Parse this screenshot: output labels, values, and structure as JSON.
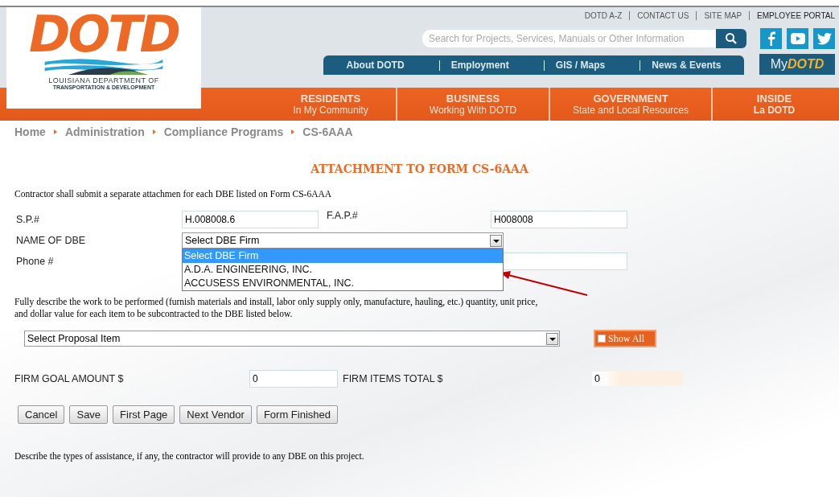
{
  "header": {
    "logo": {
      "wordmark": "DOTD",
      "line_1": "LOUISIANA DEPARTMENT OF",
      "line_2": "TRANSPORTATION & DEVELOPMENT"
    },
    "top_links": [
      "DOTD A-Z",
      "CONTACT US",
      "SITE MAP",
      "EMPLOYEE PORTAL"
    ],
    "search": {
      "placeholder": "Search for Projects, Services, Manuals or Other Information"
    },
    "secondary_nav": [
      "About DOTD",
      "Employment",
      "GIS / Maps",
      "News & Events"
    ],
    "my_dotd": {
      "prefix": "My",
      "brand": "DOTD"
    },
    "main_nav": [
      {
        "title": "RESIDENTS",
        "subtitle": "In My Community"
      },
      {
        "title": "BUSINESS",
        "subtitle": "Working With DOTD"
      },
      {
        "title": "GOVERNMENT",
        "subtitle": "State and Local Resources"
      },
      {
        "title": "INSIDE",
        "subtitle": "La DOTD"
      }
    ]
  },
  "breadcrumb": [
    "Home",
    "Administration",
    "Compliance Programs",
    "CS-6AAA"
  ],
  "form": {
    "title": "ATTACHMENT TO FORM CS-6AAA",
    "intro": "Contractor shall submit a separate attachmen for each DBE listed on Form CS-6AAA",
    "sp": {
      "label": "S.P.#",
      "value": "H.008008.6"
    },
    "fap": {
      "label": "F.A.P.#",
      "value": "H008008"
    },
    "dbe": {
      "label": "NAME OF DBE",
      "value": "Select DBE Firm",
      "expanded": true,
      "options": [
        {
          "label": "Select DBE Firm",
          "selected": true
        },
        {
          "label": "A.D.A. ENGINEERING, INC.",
          "selected": false
        },
        {
          "label": "ACCUSESS ENVIRONMENTAL, INC.",
          "selected": false
        }
      ]
    },
    "phone": {
      "label": "Phone #"
    },
    "description": "Fully describe the work to be performed (furnish materials and install, labor only supply only, manufacture, hauling, etc.) quantity, unit price, and dollar value for each item to be subcontracted to the DBE listed below.",
    "proposal": {
      "value": "Select Proposal Item"
    },
    "show_all": {
      "label": "Show All",
      "checked": false
    },
    "firm_goal": {
      "label": "FIRM GOAL AMOUNT $",
      "value": "0"
    },
    "firm_items": {
      "label": "FIRM ITEMS TOTAL $",
      "value": "0"
    },
    "buttons": [
      "Cancel",
      "Save",
      "First Page",
      "Next Vendor",
      "Form Finished"
    ],
    "assistance": "Describe the types of assistance, if any, the contractor will provide to any DBE on this project."
  }
}
